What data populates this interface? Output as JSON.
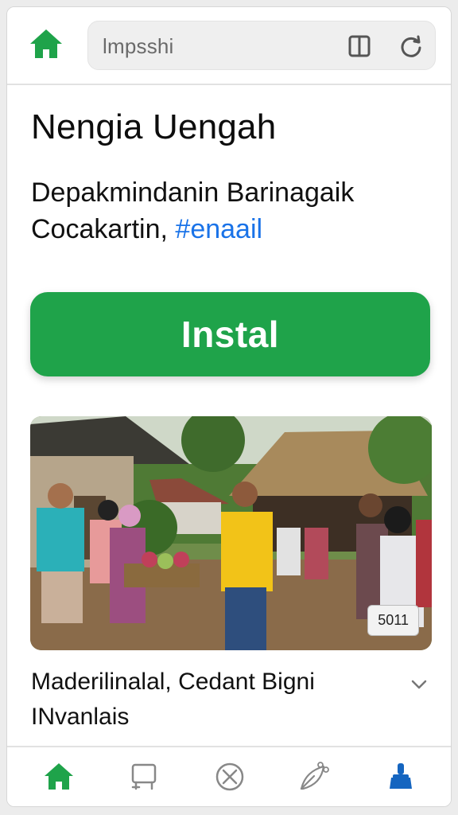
{
  "browser": {
    "url_text": "lmpsshi",
    "icons": [
      "home-icon",
      "tabs-icon",
      "reload-icon"
    ]
  },
  "page": {
    "title": "Nengia Uengah",
    "description": "Depakmindanin Barinagaik Cocakartin,",
    "hashtag": "#enaail",
    "install_label": "Instal",
    "photo_badge": "5011",
    "caption": "Maderilinalal, Cedant Bigni INvanlais"
  },
  "bottom_nav": {
    "items": [
      "home-icon",
      "crop-icon",
      "cancel-icon",
      "share-leaf-icon",
      "brush-icon"
    ],
    "active_color": "#1fa34a"
  },
  "colors": {
    "accent": "#1fa34a",
    "link": "#1a73e8",
    "active_nav": "#1565c0"
  }
}
